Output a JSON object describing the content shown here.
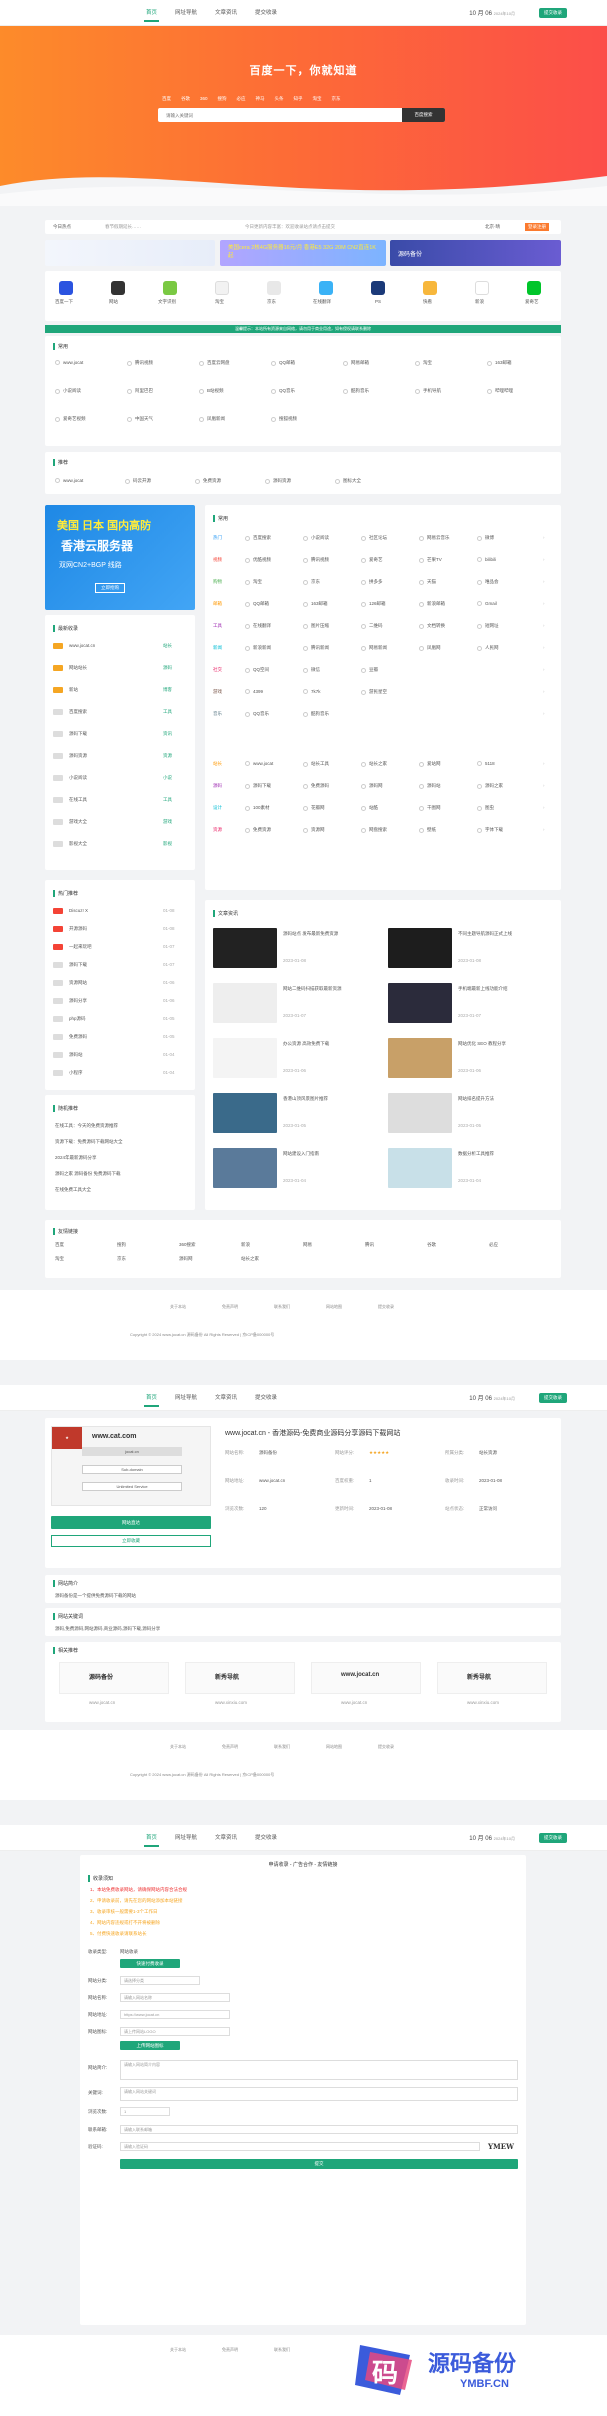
{
  "nav": [
    "首页",
    "网址导航",
    "文章资讯",
    "提交收录"
  ],
  "date": "10 月 06",
  "date2": "2024年10月",
  "add_label": "提交收录",
  "hero": {
    "title": "百度一下，你就知道",
    "engines": [
      "百度",
      "谷歌",
      "360",
      "搜狗",
      "必应",
      "神马",
      "头条",
      "知乎",
      "淘宝",
      "京东"
    ],
    "placeholder": "请输入关键词",
    "btn": "百度搜索"
  },
  "strip": {
    "label": "今日热点",
    "text": "春节假期延长……",
    "notice": "今日更新内容丰富：欢迎收录站点请点击提交",
    "weather": "北京·晴",
    "login": "登录注册"
  },
  "banners": [
    "美国cera 2核4G服务器16元/月 香港E5 32G 20M CN2直连1K起",
    "源码备份"
  ],
  "apps": [
    "百度一下",
    "网站",
    "文字识别",
    "淘宝",
    "京东",
    "在线翻译",
    "PS",
    "快看",
    "新浪",
    "爱奇艺"
  ],
  "notice_bar": "温馨提示：本站所有资源来自网络，请勿用于商业用途，如有侵权请联系删除",
  "common": {
    "title": "常用",
    "rows": [
      [
        "www.jocat",
        "腾讯视频",
        "百度云网盘",
        "QQ邮箱",
        "网易邮箱",
        "淘宝",
        "163邮箱"
      ],
      [
        "小说阅读",
        "阿里巴巴",
        "B站视频",
        "QQ音乐",
        "酷狗音乐",
        "手机导航",
        "哔哩哔哩"
      ],
      [
        "爱奇艺视频",
        "中国天气",
        "凤凰新闻",
        "搜狐视频"
      ]
    ]
  },
  "recommend": {
    "title": "推荐",
    "items": [
      "www.jocat",
      "码云开源",
      "免费资源",
      "源码资源",
      "图标大全"
    ]
  },
  "ad_box": {
    "line1": "美国 日本 国内高防",
    "line2": "香港云服务器",
    "line3": "双网CN2+BGP 线路",
    "btn": "立即抢购"
  },
  "latest": {
    "title": "最新收录",
    "items": [
      "www.jocat.cn",
      "网站站长",
      "新站",
      "百度搜索",
      "源码下载",
      "源码资源",
      "小说阅读",
      "在线工具",
      "游戏大全",
      "影视大全"
    ],
    "tags": [
      "站长",
      "源码",
      "博客",
      "工具",
      "资讯",
      "资源",
      "小说",
      "工具",
      "游戏",
      "影视"
    ]
  },
  "hot": {
    "title": "热门推荐",
    "items": [
      "Discuz! X",
      "开源源码",
      "一起来玩吧",
      "源码下载",
      "资源网站",
      "源码分享",
      "php源码",
      "免费源码",
      "源码站",
      "小程序"
    ],
    "dates": [
      "01-08",
      "01-08",
      "01-07",
      "01-07",
      "01-06",
      "01-06",
      "01-05",
      "01-05",
      "01-04",
      "01-04"
    ]
  },
  "random": {
    "title": "随机推荐",
    "items": [
      "在线工具：今天的免费资源推荐",
      "资源下载：免费源码下载网站大全",
      "2024年最新源码分享",
      "源码之家 源码备份 免费源码下载",
      "在线免费工具大全"
    ]
  },
  "categories": {
    "title": "常用",
    "rows": [
      {
        "cat": "热门",
        "items": [
          "百度搜索",
          "小说阅读",
          "社区论坛",
          "网易云音乐",
          "微博"
        ]
      },
      {
        "cat": "视频",
        "items": [
          "优酷视频",
          "腾讯视频",
          "爱奇艺",
          "芒果TV",
          "bilibili"
        ]
      },
      {
        "cat": "购物",
        "items": [
          "淘宝",
          "京东",
          "拼多多",
          "天猫",
          "唯品会"
        ]
      },
      {
        "cat": "邮箱",
        "items": [
          "QQ邮箱",
          "163邮箱",
          "126邮箱",
          "新浪邮箱",
          "Gmail"
        ]
      },
      {
        "cat": "工具",
        "items": [
          "在线翻译",
          "图片压缩",
          "二维码",
          "文档转换",
          "短网址"
        ]
      },
      {
        "cat": "新闻",
        "items": [
          "新浪新闻",
          "腾讯新闻",
          "网易新闻",
          "凤凰网",
          "人民网"
        ]
      },
      {
        "cat": "社交",
        "items": [
          "QQ空间",
          "微信",
          "豆瓣"
        ]
      },
      {
        "cat": "游戏",
        "items": [
          "4399",
          "7k7k",
          "游民星空"
        ]
      },
      {
        "cat": "音乐",
        "items": [
          "QQ音乐",
          "酷狗音乐"
        ]
      }
    ],
    "rows2": [
      {
        "cat": "站长",
        "items": [
          "www.jocat",
          "站长工具",
          "站长之家",
          "爱站网",
          "5118"
        ]
      },
      {
        "cat": "源码",
        "items": [
          "源码下载",
          "免费源码",
          "源码网",
          "源码站",
          "源码之家"
        ]
      },
      {
        "cat": "设计",
        "items": [
          "100素材",
          "花瓣网",
          "站酷",
          "千图网",
          "图虫"
        ]
      },
      {
        "cat": "资源",
        "items": [
          "免费资源",
          "资源网",
          "网盘搜索",
          "壁纸",
          "字体下载"
        ]
      }
    ]
  },
  "articles": {
    "title": "文章资讯",
    "items": [
      {
        "t": "源码站点 发布最新免费资源",
        "d": "2023-01-08"
      },
      {
        "t": "不同主题导航源码正式上线",
        "d": "2023-01-08"
      },
      {
        "t": "网站二维码扫描获取最新资源",
        "d": "2023-01-07"
      },
      {
        "t": "手机端最新上线功能介绍",
        "d": "2023-01-07"
      },
      {
        "t": "办公资源 高效免费下载",
        "d": "2023-01-06"
      },
      {
        "t": "网站优化 SEO 教程分享",
        "d": "2023-01-06"
      },
      {
        "t": "香港山顶风景图片推荐",
        "d": "2023-01-05"
      },
      {
        "t": "网站排名提升方法",
        "d": "2023-01-05"
      },
      {
        "t": "网站建设入门指南",
        "d": "2023-01-04"
      },
      {
        "t": "数据分析工具推荐",
        "d": "2023-01-04"
      }
    ]
  },
  "friends": {
    "title": "友情链接",
    "items": [
      "百度",
      "搜狗",
      "360搜索",
      "新浪",
      "网易",
      "腾讯",
      "谷歌",
      "必应",
      "淘宝",
      "京东",
      "源码网",
      "站长之家"
    ]
  },
  "footer": {
    "links": [
      "关于本站",
      "免责声明",
      "联系我们",
      "网站地图",
      "提交收录"
    ],
    "copyright": "Copyright © 2024 www.jocat.cn 源码备份 All Rights Reserved | 京ICP备000000号"
  },
  "detail": {
    "title": "www.jocat.cn - 香港源码-免费商业源码分享源码下载网站",
    "shot_logo": "www.cat.com",
    "shot_lines": [
      "jocat.cn",
      "Sub-domain",
      "Unlimited Service"
    ],
    "visit_btn": "网站直达",
    "share_btn": "立即收藏",
    "fields": [
      {
        "k": "网站名称:",
        "v": "源码备份"
      },
      {
        "k": "网站评分:",
        "v": "★★★★★"
      },
      {
        "k": "所属分类:",
        "v": "站长资源"
      },
      {
        "k": "网站地址:",
        "v": "www.jocat.cn"
      },
      {
        "k": "百度权重:",
        "v": "1"
      },
      {
        "k": "收录时间:",
        "v": "2023-01-08"
      },
      {
        "k": "浏览次数:",
        "v": "120"
      },
      {
        "k": "更新时间:",
        "v": "2023-01-08"
      },
      {
        "k": "站点状态:",
        "v": "正常访问"
      }
    ],
    "intro_title": "网站简介",
    "intro_text": "源码备份是一个提供免费源码下载的网站",
    "tags_title": "网站关键词",
    "tags_text": "源码,免费源码,网站源码,商业源码,源码下载,源码分享",
    "rel_title": "相关推荐",
    "rel": [
      {
        "n": "源码备份",
        "u": "www.jocat.cn"
      },
      {
        "n": "新秀导航",
        "u": "www.xinxiu.com"
      },
      {
        "n": "www.jocat.cn",
        "u": "www.jocat.cn"
      },
      {
        "n": "新秀导航",
        "u": "www.xinxiu.com"
      }
    ]
  },
  "submit": {
    "title": "申请收录 - 广告合作 - 友情链接",
    "notice_title": "收录须知",
    "notices": [
      "1、本站免费收录网站，请确保网站内容合法合规",
      "2、申请收录前，请先在您的网站添加本站链接",
      "3、收录审核一般需要1-3个工作日",
      "4、网站内容违规或打不开将被删除",
      "5、付费快速收录请联系站长"
    ],
    "f_type": "收录类型:",
    "type_val": "网站收录",
    "pay_btn": "快速付费收录",
    "f_cat": "网站分类:",
    "cat_val": "请选择分类",
    "f_name": "网站名称:",
    "name_ph": "请输入网站名称",
    "f_url": "网站地址:",
    "url_ph": "https://www.jocat.cn",
    "f_logo": "网站图标:",
    "logo_ph": "请上传网站LOGO",
    "upload_btn": "上传网站图标",
    "f_desc": "网站简介:",
    "desc_ph": "请输入网站简介内容",
    "f_key": "关键词:",
    "key_ph": "请输入网站关键词",
    "f_num": "浏览次数:",
    "num_val": "1",
    "f_mail": "联系邮箱:",
    "mail_ph": "请输入联系邮箱",
    "f_code": "验证码:",
    "code_ph": "请输入验证码",
    "captcha": "YMEW",
    "submit_btn": "提交"
  },
  "watermark": {
    "cn": "源码备份",
    "en": "YMBF.CN"
  }
}
